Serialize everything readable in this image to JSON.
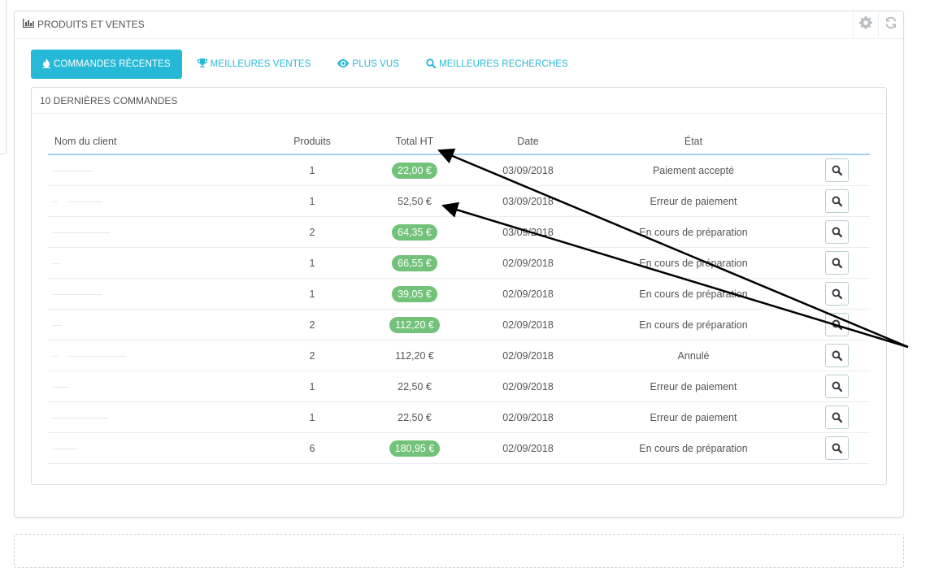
{
  "panel": {
    "title": "PRODUITS ET VENTES",
    "title_icon": "bar-chart-icon",
    "tools": [
      "gear-icon",
      "refresh-icon"
    ]
  },
  "tabs": [
    {
      "label": "COMMANDES RÉCENTES",
      "icon": "fire-icon",
      "active": true
    },
    {
      "label": "MEILLEURES VENTES",
      "icon": "trophy-icon",
      "active": false
    },
    {
      "label": "PLUS VUS",
      "icon": "eye-icon",
      "active": false
    },
    {
      "label": "MEILLEURES RECHERCHES",
      "icon": "search-icon",
      "active": false
    }
  ],
  "orders": {
    "title": "10 DERNIÈRES COMMANDES",
    "columns": [
      "Nom du client",
      "Produits",
      "Total HT",
      "Date",
      "État"
    ],
    "rows": [
      {
        "products": "1",
        "total": "22,00 €",
        "highlight": true,
        "date": "03/09/2018",
        "status": "Paiement accepté"
      },
      {
        "products": "1",
        "total": "52,50 €",
        "highlight": false,
        "date": "03/09/2018",
        "status": "Erreur de paiement"
      },
      {
        "products": "2",
        "total": "64,35 €",
        "highlight": true,
        "date": "03/09/2018",
        "status": "En cours de préparation"
      },
      {
        "products": "1",
        "total": "66,55 €",
        "highlight": true,
        "date": "02/09/2018",
        "status": "En cours de préparation"
      },
      {
        "products": "1",
        "total": "39,05 €",
        "highlight": true,
        "date": "02/09/2018",
        "status": "En cours de préparation"
      },
      {
        "products": "2",
        "total": "112,20 €",
        "highlight": true,
        "date": "02/09/2018",
        "status": "En cours de préparation"
      },
      {
        "products": "2",
        "total": "112,20 €",
        "highlight": false,
        "date": "02/09/2018",
        "status": "Annulé"
      },
      {
        "products": "1",
        "total": "22,50 €",
        "highlight": false,
        "date": "02/09/2018",
        "status": "Erreur de paiement"
      },
      {
        "products": "1",
        "total": "22,50 €",
        "highlight": false,
        "date": "02/09/2018",
        "status": "Erreur de paiement"
      },
      {
        "products": "6",
        "total": "180,95 €",
        "highlight": true,
        "date": "02/09/2018",
        "status": "En cours de préparation"
      }
    ]
  },
  "colors": {
    "accent": "#25b9d7",
    "badge_green": "#72c279",
    "header_rule": "#a0d0eb"
  }
}
